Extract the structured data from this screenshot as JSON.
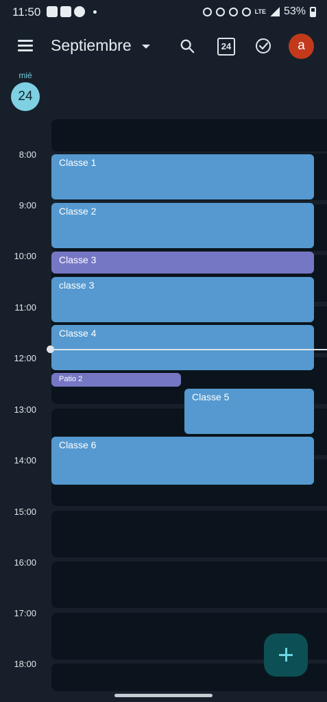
{
  "status": {
    "time": "11:50",
    "battery": "53%",
    "network": "LTE"
  },
  "appbar": {
    "month": "Septiembre",
    "today_day": "24",
    "avatar_letter": "a"
  },
  "day": {
    "name": "mié",
    "number": "24"
  },
  "hours": [
    "8:00",
    "9:00",
    "10:00",
    "11:00",
    "12:00",
    "13:00",
    "14:00",
    "15:00",
    "16:00",
    "17:00",
    "18:00"
  ],
  "events": [
    {
      "title": "Classe 1"
    },
    {
      "title": "Classe 2"
    },
    {
      "title": "Classe 3"
    },
    {
      "title": "classe 3"
    },
    {
      "title": "Classe 4"
    },
    {
      "title": "Patio 2"
    },
    {
      "title": "Classe 5"
    },
    {
      "title": "Classe 6"
    }
  ],
  "colors": {
    "background": "#17202a",
    "event_blue": "#5599d0",
    "event_purple": "#7677c4",
    "accent_today": "#7fd0e3",
    "avatar": "#c2391c",
    "fab": "#0c4f55"
  },
  "icons": [
    "menu-icon",
    "dropdown-caret-icon",
    "search-icon",
    "today-icon",
    "tasks-icon",
    "add-icon"
  ]
}
